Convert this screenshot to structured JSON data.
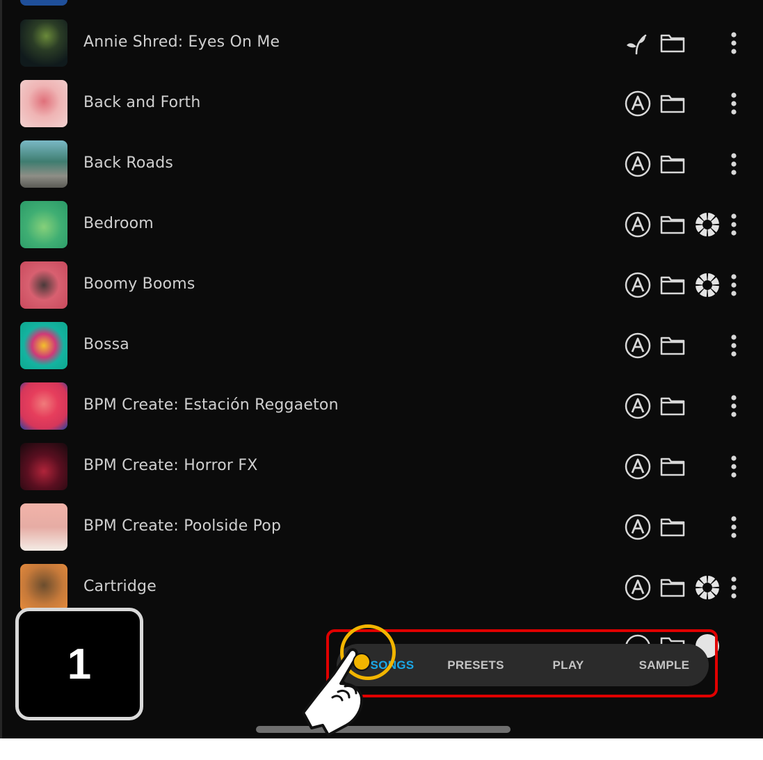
{
  "songs": [
    {
      "title": "Annie Shred: Eyes On Me",
      "source_icon": "sprout-icon",
      "has_pack_icon": false
    },
    {
      "title": "Back and Forth",
      "source_icon": "artist-a-icon",
      "has_pack_icon": false
    },
    {
      "title": "Back Roads",
      "source_icon": "artist-a-icon",
      "has_pack_icon": false
    },
    {
      "title": "Bedroom",
      "source_icon": "artist-a-icon",
      "has_pack_icon": true
    },
    {
      "title": "Boomy Booms",
      "source_icon": "artist-a-icon",
      "has_pack_icon": true
    },
    {
      "title": "Bossa",
      "source_icon": "artist-a-icon",
      "has_pack_icon": false
    },
    {
      "title": "BPM Create: Estación Reggaeton",
      "source_icon": "artist-a-icon",
      "has_pack_icon": false
    },
    {
      "title": "BPM Create: Horror FX",
      "source_icon": "artist-a-icon",
      "has_pack_icon": false
    },
    {
      "title": "BPM Create: Poolside Pop",
      "source_icon": "artist-a-icon",
      "has_pack_icon": false
    },
    {
      "title": "Cartridge",
      "source_icon": "artist-a-icon",
      "has_pack_icon": true
    }
  ],
  "tabs": [
    {
      "label": "SONGS",
      "active": true
    },
    {
      "label": "PRESETS",
      "active": false
    },
    {
      "label": "PLAY",
      "active": false
    },
    {
      "label": "SAMPLE",
      "active": false
    }
  ],
  "tutorial": {
    "step_number": "1"
  },
  "colors": {
    "background": "#0b0b0b",
    "text": "#cfcfcf",
    "active_tab": "#1aa8e8",
    "highlight": "#e00000",
    "tap_ring": "#f2b500"
  }
}
